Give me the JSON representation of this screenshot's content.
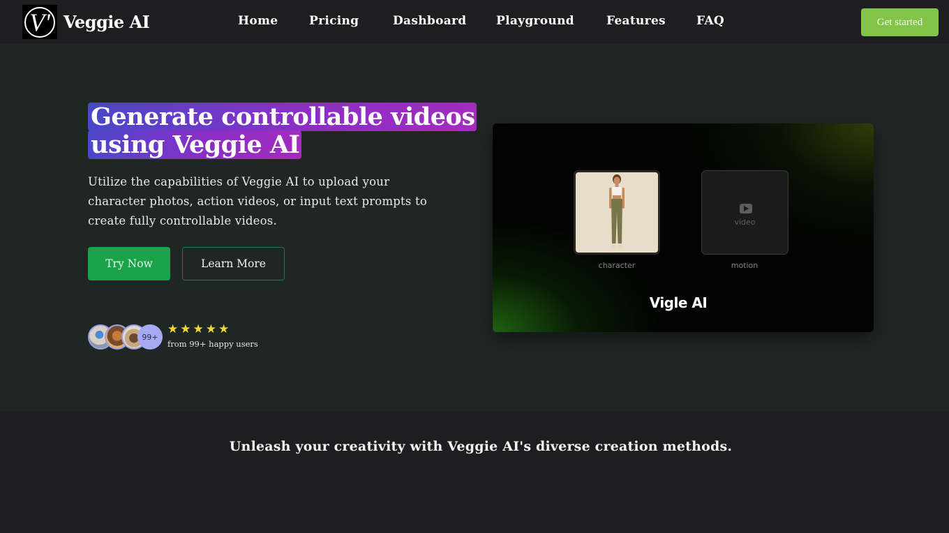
{
  "brand": {
    "logo_glyph": "V'",
    "name": "Veggie AI"
  },
  "nav": {
    "items": [
      {
        "label": "Home"
      },
      {
        "label": "Pricing"
      },
      {
        "label": "Dashboard"
      },
      {
        "label": "Playground"
      },
      {
        "label": "Features"
      },
      {
        "label": "FAQ"
      }
    ],
    "cta_label": "Get started"
  },
  "hero": {
    "headline_line1": "Generate controllable videos",
    "headline_line2": "using Veggie AI",
    "description": "Utilize the capabilities of Veggie AI to upload your character photos, action videos, or input text prompts to create fully controllable videos.",
    "primary_button": "Try Now",
    "secondary_button": "Learn More",
    "social_proof": {
      "avatar_count_label": "99+",
      "rating_stars": 5,
      "stars": [
        "★",
        "★",
        "★",
        "★",
        "★"
      ],
      "caption": "from 99+ happy users"
    }
  },
  "demo_card": {
    "character_caption": "character",
    "motion_caption": "motion",
    "motion_placeholder": "video",
    "title": "Vigle AI"
  },
  "features": {
    "heading": "Unleash your creativity with Veggie AI's diverse creation methods."
  },
  "colors": {
    "cta_green": "#82c34a",
    "primary_button": "#1aa34a",
    "outline_border": "#1e7a46",
    "headline_gradient_start": "#4a47c9",
    "headline_gradient_end": "#a32cbe",
    "star": "#f5d73a",
    "avatar_badge": "#a6aaf5"
  }
}
